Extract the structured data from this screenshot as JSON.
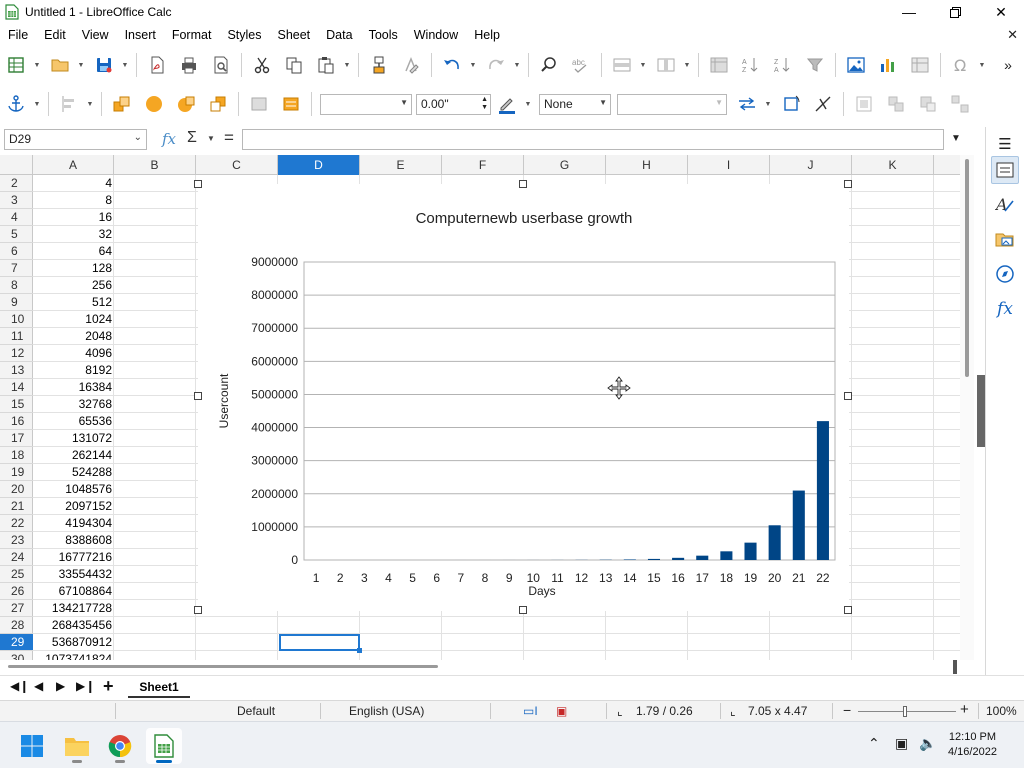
{
  "window": {
    "title": "Untitled 1 - LibreOffice Calc"
  },
  "menu": [
    "File",
    "Edit",
    "View",
    "Insert",
    "Format",
    "Styles",
    "Sheet",
    "Data",
    "Tools",
    "Window",
    "Help"
  ],
  "toolbar2": {
    "line_width": "0.00\"",
    "area_style": "None",
    "area_fill": ""
  },
  "formula_bar": {
    "name_box": "D29",
    "formula": ""
  },
  "columns": [
    "A",
    "B",
    "C",
    "D",
    "E",
    "F",
    "G",
    "H",
    "I",
    "J",
    "K"
  ],
  "active_column": "D",
  "rows": [
    {
      "n": "2",
      "a": "4"
    },
    {
      "n": "3",
      "a": "8"
    },
    {
      "n": "4",
      "a": "16"
    },
    {
      "n": "5",
      "a": "32"
    },
    {
      "n": "6",
      "a": "64"
    },
    {
      "n": "7",
      "a": "128"
    },
    {
      "n": "8",
      "a": "256"
    },
    {
      "n": "9",
      "a": "512"
    },
    {
      "n": "10",
      "a": "1024"
    },
    {
      "n": "11",
      "a": "2048"
    },
    {
      "n": "12",
      "a": "4096"
    },
    {
      "n": "13",
      "a": "8192"
    },
    {
      "n": "14",
      "a": "16384"
    },
    {
      "n": "15",
      "a": "32768"
    },
    {
      "n": "16",
      "a": "65536"
    },
    {
      "n": "17",
      "a": "131072"
    },
    {
      "n": "18",
      "a": "262144"
    },
    {
      "n": "19",
      "a": "524288"
    },
    {
      "n": "20",
      "a": "1048576"
    },
    {
      "n": "21",
      "a": "2097152"
    },
    {
      "n": "22",
      "a": "4194304"
    },
    {
      "n": "23",
      "a": "8388608"
    },
    {
      "n": "24",
      "a": "16777216"
    },
    {
      "n": "25",
      "a": "33554432"
    },
    {
      "n": "26",
      "a": "67108864"
    },
    {
      "n": "27",
      "a": "134217728"
    },
    {
      "n": "28",
      "a": "268435456"
    },
    {
      "n": "29",
      "a": "536870912"
    },
    {
      "n": "30",
      "a": "1073741824"
    }
  ],
  "active_row": "29",
  "chart_data": {
    "type": "bar",
    "title": "Computernewb userbase growth",
    "xlabel": "Days",
    "ylabel": "Usercount",
    "categories": [
      "1",
      "2",
      "3",
      "4",
      "5",
      "6",
      "7",
      "8",
      "9",
      "10",
      "11",
      "12",
      "13",
      "14",
      "15",
      "16",
      "17",
      "18",
      "19",
      "20",
      "21",
      "22"
    ],
    "values": [
      2,
      4,
      8,
      16,
      32,
      64,
      128,
      256,
      512,
      1024,
      2048,
      4096,
      8192,
      16384,
      32768,
      65536,
      131072,
      262144,
      524288,
      1048576,
      2097152,
      4194304
    ],
    "yticks": [
      "0",
      "1000000",
      "2000000",
      "3000000",
      "4000000",
      "5000000",
      "6000000",
      "7000000",
      "8000000",
      "9000000"
    ],
    "ylim": [
      0,
      9000000
    ],
    "grid": true,
    "legend": "none",
    "bar_color": "#004586"
  },
  "sheet_tabs": [
    "Sheet1"
  ],
  "status": {
    "page_style": "Default",
    "language": "English (USA)",
    "position": "1.79 / 0.26",
    "size": "7.05 x 4.47",
    "zoom": "100%"
  },
  "taskbar": {
    "time": "12:10 PM",
    "date": "4/16/2022"
  },
  "colors": {
    "accent": "#1f78d1",
    "bar": "#004586"
  }
}
